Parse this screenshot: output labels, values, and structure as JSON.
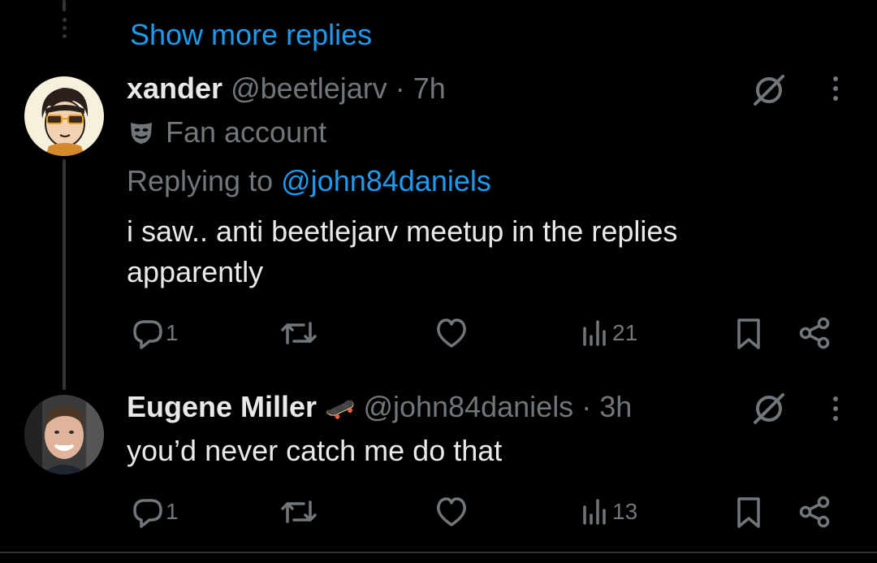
{
  "thread": {
    "show_more_label": "Show more replies"
  },
  "tweets": [
    {
      "display_name": "xander",
      "handle": "@beetlejarv",
      "separator": "·",
      "time": "7h",
      "badge_label": "Fan account",
      "badge_icon": "theater-mask-icon",
      "replying_prefix": "Replying to",
      "replying_to": "@john84daniels",
      "text": "i saw.. anti beetlejarv meetup in the replies apparently",
      "reply_count": "1",
      "repost_count": "",
      "like_count": "",
      "view_count": "21"
    },
    {
      "display_name": "Eugene Miller",
      "name_emoji": "🛹",
      "handle": "@john84daniels",
      "separator": "·",
      "time": "3h",
      "text": "you’d never catch me do that",
      "reply_count": "1",
      "repost_count": "",
      "like_count": "",
      "view_count": "13"
    }
  ],
  "colors": {
    "background": "#000000",
    "text": "#e7e9ea",
    "muted": "#71767b",
    "accent": "#1d9bf0",
    "thread_line": "#333639"
  }
}
